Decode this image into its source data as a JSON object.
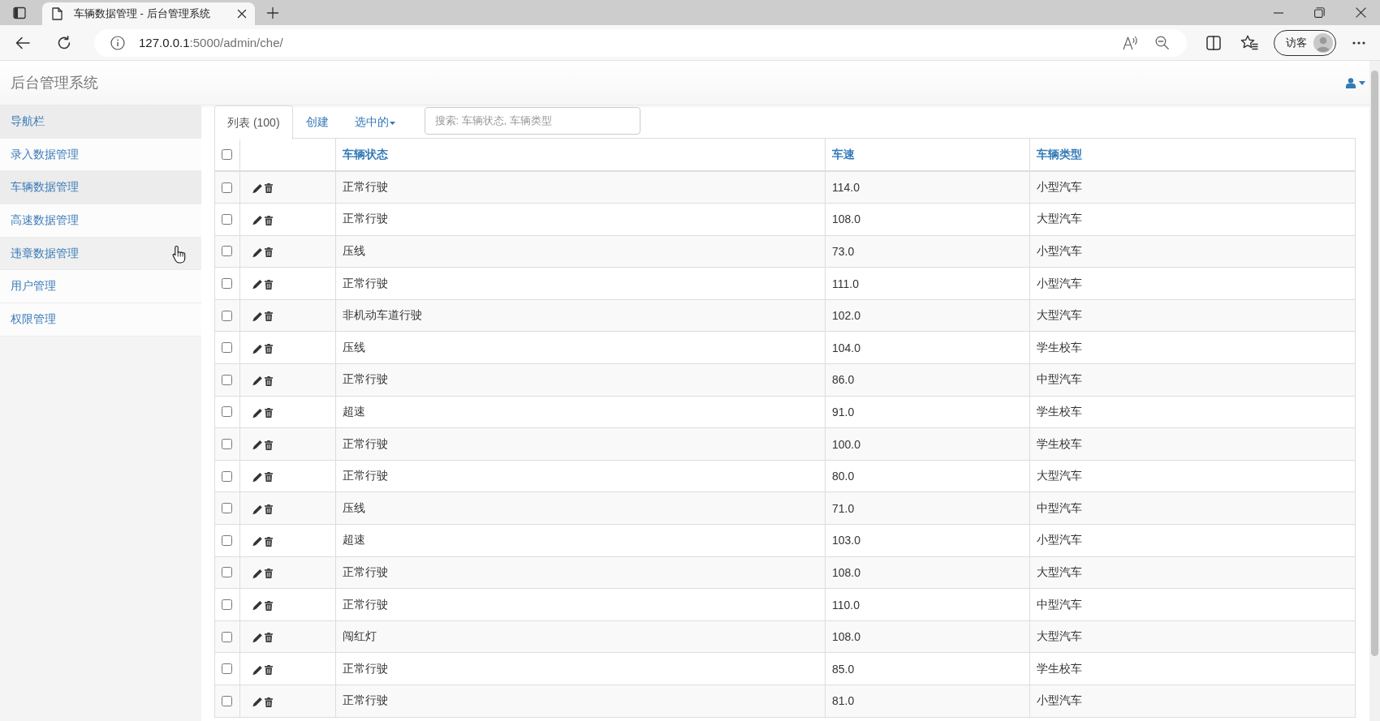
{
  "browser": {
    "tab": {
      "title": "车辆数据管理 - 后台管理系统",
      "selected": true
    },
    "url": {
      "host": "127.0.0.1",
      "path": ":5000/admin/che/"
    },
    "profile": {
      "label": "访客"
    }
  },
  "navbar": {
    "brand": "后台管理系统"
  },
  "sidebar": {
    "title": "导航栏",
    "items": [
      {
        "label": "录入数据管理",
        "selected": false,
        "hovered": false
      },
      {
        "label": "车辆数据管理",
        "selected": true,
        "hovered": false
      },
      {
        "label": "高速数据管理",
        "selected": false,
        "hovered": false
      },
      {
        "label": "违章数据管理",
        "selected": false,
        "hovered": true
      },
      {
        "label": "用户管理",
        "selected": false,
        "hovered": false
      },
      {
        "label": "权限管理",
        "selected": false,
        "hovered": false
      }
    ]
  },
  "tabs": [
    {
      "label": "列表 (100)",
      "kind": "tab",
      "selected": true
    },
    {
      "label": "创建",
      "kind": "tab",
      "selected": false
    },
    {
      "label": "选中的",
      "kind": "dropdown",
      "selected": false
    }
  ],
  "search": {
    "placeholder": "搜索: 车辆状态, 车辆类型"
  },
  "table": {
    "select_all": {
      "checked": false
    },
    "columns": [
      {
        "label": "车辆状态"
      },
      {
        "label": "车速"
      },
      {
        "label": "车辆类型"
      }
    ],
    "rows": [
      {
        "checked": false,
        "cells": [
          "正常行驶",
          "114.0",
          "小型汽车"
        ]
      },
      {
        "checked": false,
        "cells": [
          "正常行驶",
          "108.0",
          "大型汽车"
        ]
      },
      {
        "checked": false,
        "cells": [
          "压线",
          "73.0",
          "小型汽车"
        ]
      },
      {
        "checked": false,
        "cells": [
          "正常行驶",
          "111.0",
          "小型汽车"
        ]
      },
      {
        "checked": false,
        "cells": [
          "非机动车道行驶",
          "102.0",
          "大型汽车"
        ]
      },
      {
        "checked": false,
        "cells": [
          "压线",
          "104.0",
          "学生校车"
        ]
      },
      {
        "checked": false,
        "cells": [
          "正常行驶",
          "86.0",
          "中型汽车"
        ]
      },
      {
        "checked": false,
        "cells": [
          "超速",
          "91.0",
          "学生校车"
        ]
      },
      {
        "checked": false,
        "cells": [
          "正常行驶",
          "100.0",
          "学生校车"
        ]
      },
      {
        "checked": false,
        "cells": [
          "正常行驶",
          "80.0",
          "大型汽车"
        ]
      },
      {
        "checked": false,
        "cells": [
          "压线",
          "71.0",
          "中型汽车"
        ]
      },
      {
        "checked": false,
        "cells": [
          "超速",
          "103.0",
          "小型汽车"
        ]
      },
      {
        "checked": false,
        "cells": [
          "正常行驶",
          "108.0",
          "大型汽车"
        ]
      },
      {
        "checked": false,
        "cells": [
          "正常行驶",
          "110.0",
          "中型汽车"
        ]
      },
      {
        "checked": false,
        "cells": [
          "闯红灯",
          "108.0",
          "大型汽车"
        ]
      },
      {
        "checked": false,
        "cells": [
          "正常行驶",
          "85.0",
          "学生校车"
        ]
      },
      {
        "checked": false,
        "cells": [
          "正常行驶",
          "81.0",
          "小型汽车"
        ]
      }
    ]
  }
}
